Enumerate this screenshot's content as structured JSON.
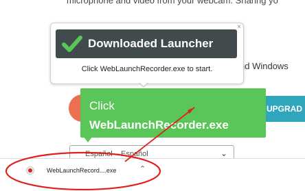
{
  "page": {
    "intro_text": "microphone and video from your webcam. Sharing yo",
    "windows_text": "nd Windows"
  },
  "popover": {
    "banner_text": "Downloaded Launcher",
    "subtitle": "Click WebLaunchRecorder.exe to start.",
    "close_label": "×"
  },
  "upgrade": {
    "label": "UPGRAD"
  },
  "callout": {
    "line1": "Click",
    "line2": "WebLaunchRecorder.exe"
  },
  "language": {
    "selected": "Español – Español"
  },
  "download_bar": {
    "file_name": "WebLaunchRecord....exe"
  },
  "colors": {
    "banner_bg": "#414a4c",
    "check_green": "#5bc658",
    "callout_green": "#5bc658",
    "annotation_red": "#e0201a",
    "upgrade_teal": "#2fa6bb",
    "orange": "#ee6f4f"
  },
  "icons": {
    "banner": "check-icon",
    "windows": "windows-logo-icon",
    "download": "record-icon",
    "chevron": "chevron-up-icon",
    "select_chevron": "chevron-down-icon"
  }
}
